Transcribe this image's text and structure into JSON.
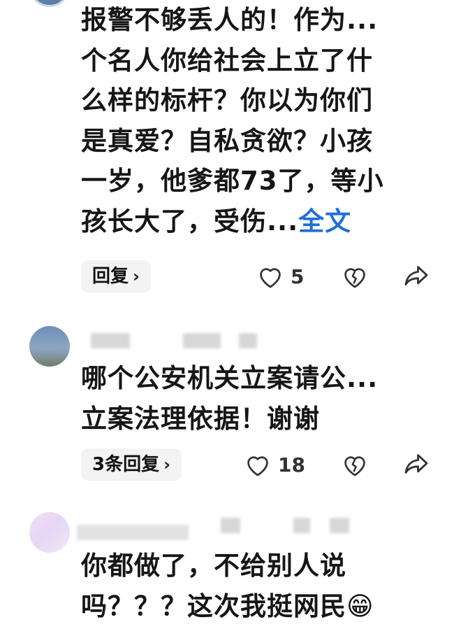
{
  "comments": [
    {
      "lines": [
        "报警不够丢人的！作为...",
        "个名人你给社会上立了什",
        "么样的标杆？你以为你们",
        "是真爱？自私贪欲？小孩",
        "一岁，他爹都73了，等小",
        "孩长大了，受伤..."
      ],
      "full_text_link": "全文",
      "reply_label": "回复",
      "like_count": "5"
    },
    {
      "lines": [
        "哪个公安机关立案请公...",
        "立案法理依据！谢谢"
      ],
      "reply_label": "3条回复",
      "like_count": "18"
    },
    {
      "lines": [
        "你都做了，不给别人说",
        "吗？？？这次我挺网民"
      ],
      "emoji": "😁"
    }
  ],
  "icons": {
    "like": "heart-outline-icon",
    "dislike": "broken-heart-icon",
    "share": "share-arrow-icon",
    "reply_chevron": "chevron-right-icon"
  },
  "colors": {
    "link": "#1f6fd8",
    "reply_bg": "#f3f3f3",
    "icon": "#333333"
  }
}
